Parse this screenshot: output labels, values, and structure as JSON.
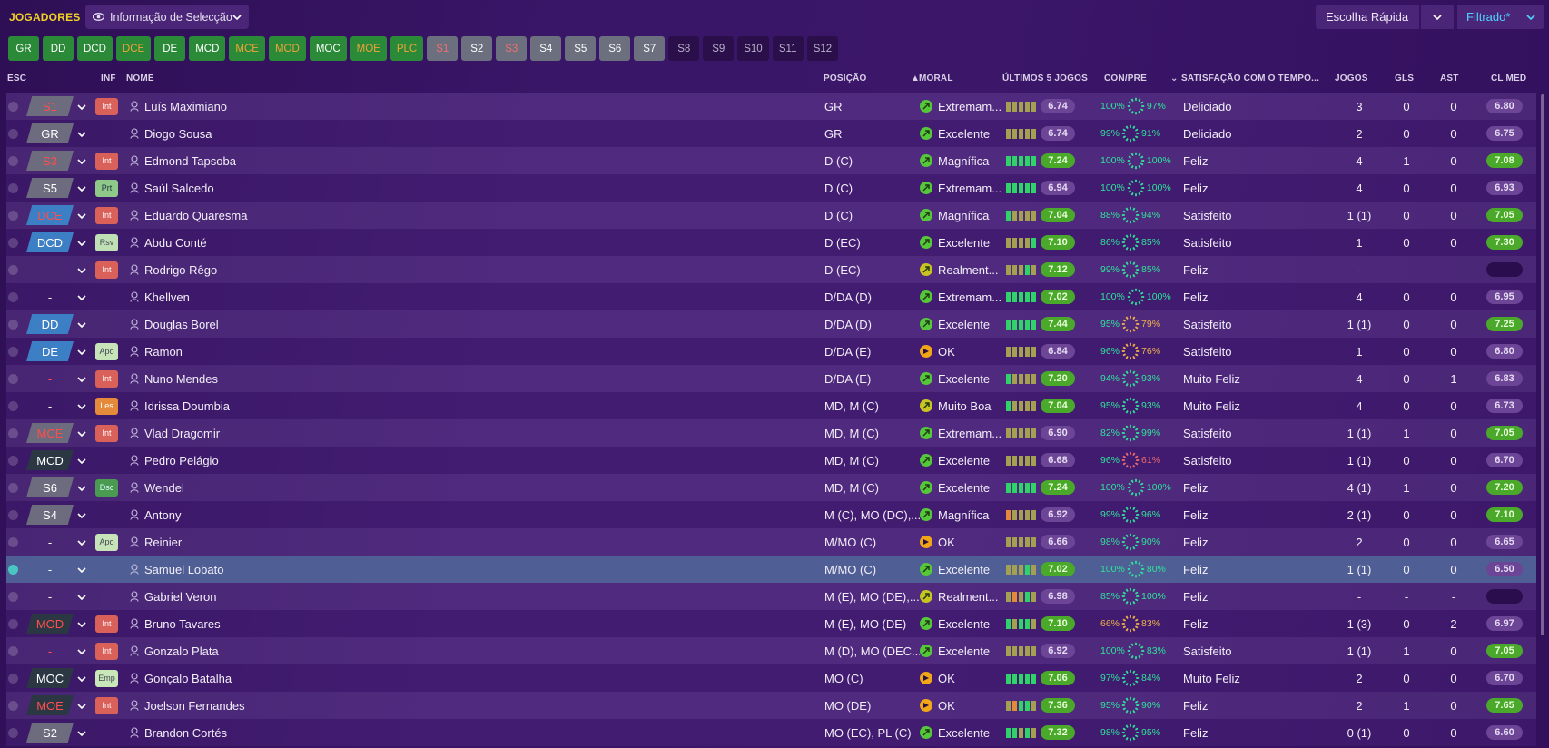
{
  "header": {
    "title": "JOGADORES",
    "view_select": "Informação de Selecção",
    "quick_pick": "Escolha Rápida",
    "filter": "Filtrado*"
  },
  "chips": [
    {
      "label": "GR",
      "style": "green"
    },
    {
      "label": "DD",
      "style": "green"
    },
    {
      "label": "DCD",
      "style": "green"
    },
    {
      "label": "DCE",
      "style": "green red"
    },
    {
      "label": "DE",
      "style": "green"
    },
    {
      "label": "MCD",
      "style": "green"
    },
    {
      "label": "MCE",
      "style": "green red"
    },
    {
      "label": "MOD",
      "style": "green red"
    },
    {
      "label": "MOC",
      "style": "green"
    },
    {
      "label": "MOE",
      "style": "green red"
    },
    {
      "label": "PLC",
      "style": "green red"
    },
    {
      "label": "S1",
      "style": "grey red"
    },
    {
      "label": "S2",
      "style": "grey"
    },
    {
      "label": "S3",
      "style": "grey red"
    },
    {
      "label": "S4",
      "style": "grey"
    },
    {
      "label": "S5",
      "style": "grey"
    },
    {
      "label": "S6",
      "style": "grey"
    },
    {
      "label": "S7",
      "style": "grey"
    },
    {
      "label": "S8",
      "style": "dark"
    },
    {
      "label": "S9",
      "style": "dark"
    },
    {
      "label": "S10",
      "style": "dark"
    },
    {
      "label": "S11",
      "style": "dark"
    },
    {
      "label": "S12",
      "style": "dark"
    }
  ],
  "columns": {
    "esc": "ESC",
    "inf": "INF",
    "nome": "NOME",
    "posicao": "POSIÇÃO",
    "moral": "MORAL",
    "ultimos5": "ÚLTIMOS 5 JOGOS",
    "conpre": "CON/PRE",
    "satisfacao": "SATISFAÇÃO COM O TEMPO...",
    "jogos": "JOGOS",
    "gls": "GLS",
    "ast": "AST",
    "clmed": "CL MED"
  },
  "colors": {
    "bar_green": "#2fd36a",
    "bar_olive": "#a3a052",
    "bar_orange": "#e08a3a",
    "ring_green": "#2fe39a",
    "ring_orange": "#f0b24a",
    "ring_red": "#ef6a6a"
  },
  "players": [
    {
      "esc": "S1",
      "esc_style": "grey",
      "esc_red": true,
      "inf": "Int",
      "inf_style": "b-int",
      "name": "Luís Maximiano",
      "pos": "GR",
      "moral": "Extremam...",
      "moral_icon": "green",
      "bars": [
        "o",
        "o",
        "o",
        "o",
        "o"
      ],
      "rating": "6.74",
      "rating_style": "r-purple",
      "con": "100%",
      "pre": "97%",
      "ring": "green",
      "satis": "Deliciado",
      "jogos": "3",
      "gls": "0",
      "ast": "0",
      "clmed": "6.80",
      "clmed_style": "r-purple"
    },
    {
      "esc": "GR",
      "esc_style": "grey",
      "esc_red": false,
      "inf": "",
      "inf_style": "",
      "name": "Diogo Sousa",
      "pos": "GR",
      "moral": "Excelente",
      "moral_icon": "green",
      "bars": [
        "o",
        "o",
        "o",
        "o",
        "o"
      ],
      "rating": "6.74",
      "rating_style": "r-purple",
      "con": "99%",
      "pre": "91%",
      "ring": "green",
      "satis": "Deliciado",
      "jogos": "2",
      "gls": "0",
      "ast": "0",
      "clmed": "6.75",
      "clmed_style": "r-purple"
    },
    {
      "esc": "S3",
      "esc_style": "grey",
      "esc_red": true,
      "inf": "Int",
      "inf_style": "b-int",
      "name": "Edmond Tapsoba",
      "pos": "D (C)",
      "moral": "Magnífica",
      "moral_icon": "green",
      "bars": [
        "g",
        "g",
        "g",
        "g",
        "g"
      ],
      "rating": "7.24",
      "rating_style": "r-green",
      "con": "100%",
      "pre": "100%",
      "ring": "green",
      "satis": "Feliz",
      "jogos": "4",
      "gls": "1",
      "ast": "0",
      "clmed": "7.08",
      "clmed_style": "r-green"
    },
    {
      "esc": "S5",
      "esc_style": "grey",
      "esc_red": false,
      "inf": "Prt",
      "inf_style": "b-prt",
      "name": "Saúl Salcedo",
      "pos": "D (C)",
      "moral": "Extremam...",
      "moral_icon": "green",
      "bars": [
        "g",
        "g",
        "g",
        "g",
        "g"
      ],
      "rating": "6.94",
      "rating_style": "r-purple",
      "con": "100%",
      "pre": "100%",
      "ring": "green",
      "satis": "Feliz",
      "jogos": "4",
      "gls": "0",
      "ast": "0",
      "clmed": "6.93",
      "clmed_style": "r-purple"
    },
    {
      "esc": "DCE",
      "esc_style": "blue",
      "esc_red": true,
      "inf": "Int",
      "inf_style": "b-int",
      "name": "Eduardo Quaresma",
      "pos": "D (C)",
      "moral": "Magnífica",
      "moral_icon": "green",
      "bars": [
        "g",
        "o",
        "o",
        "o",
        "o"
      ],
      "rating": "7.04",
      "rating_style": "r-green",
      "con": "88%",
      "pre": "94%",
      "ring": "green",
      "satis": "Satisfeito",
      "jogos": "1 (1)",
      "gls": "0",
      "ast": "0",
      "clmed": "7.05",
      "clmed_style": "r-green"
    },
    {
      "esc": "DCD",
      "esc_style": "blue",
      "esc_red": false,
      "inf": "Rsv",
      "inf_style": "b-rsv",
      "name": "Abdu Conté",
      "pos": "D (EC)",
      "moral": "Excelente",
      "moral_icon": "green",
      "bars": [
        "o",
        "o",
        "o",
        "o",
        "g"
      ],
      "rating": "7.10",
      "rating_style": "r-green",
      "con": "86%",
      "pre": "85%",
      "ring": "green",
      "satis": "Satisfeito",
      "jogos": "1",
      "gls": "0",
      "ast": "0",
      "clmed": "7.30",
      "clmed_style": "r-green"
    },
    {
      "esc": "-",
      "esc_style": "none",
      "esc_red": true,
      "inf": "Int",
      "inf_style": "b-int",
      "name": "Rodrigo Rêgo",
      "pos": "D (EC)",
      "moral": "Realment...",
      "moral_icon": "yellow",
      "bars": [
        "o",
        "o",
        "o",
        "g",
        "o"
      ],
      "rating": "7.12",
      "rating_style": "r-green",
      "con": "99%",
      "pre": "85%",
      "ring": "green",
      "satis": "Feliz",
      "jogos": "-",
      "gls": "-",
      "ast": "-",
      "clmed": "",
      "clmed_style": "r-empty"
    },
    {
      "esc": "-",
      "esc_style": "none",
      "esc_red": false,
      "inf": "",
      "inf_style": "",
      "name": "Khellven",
      "pos": "D/DA (D)",
      "moral": "Extremam...",
      "moral_icon": "green",
      "bars": [
        "g",
        "g",
        "g",
        "g",
        "g"
      ],
      "rating": "7.02",
      "rating_style": "r-green",
      "con": "100%",
      "pre": "100%",
      "ring": "green",
      "satis": "Feliz",
      "jogos": "4",
      "gls": "0",
      "ast": "0",
      "clmed": "6.95",
      "clmed_style": "r-purple"
    },
    {
      "esc": "DD",
      "esc_style": "blue",
      "esc_red": false,
      "inf": "",
      "inf_style": "",
      "name": "Douglas Borel",
      "pos": "D/DA (D)",
      "moral": "Excelente",
      "moral_icon": "green",
      "bars": [
        "g",
        "g",
        "g",
        "g",
        "g"
      ],
      "rating": "7.44",
      "rating_style": "r-green",
      "con": "95%",
      "pre": "79%",
      "ring": "orange",
      "satis": "Satisfeito",
      "jogos": "1 (1)",
      "gls": "0",
      "ast": "0",
      "clmed": "7.25",
      "clmed_style": "r-green"
    },
    {
      "esc": "DE",
      "esc_style": "blue",
      "esc_red": false,
      "inf": "Apo",
      "inf_style": "b-apo",
      "name": "Ramon",
      "pos": "D/DA (E)",
      "moral": "OK",
      "moral_icon": "orange",
      "bars": [
        "o",
        "o",
        "o",
        "o",
        "o"
      ],
      "rating": "6.84",
      "rating_style": "r-purple",
      "con": "96%",
      "pre": "76%",
      "ring": "orange",
      "satis": "Satisfeito",
      "jogos": "1",
      "gls": "0",
      "ast": "0",
      "clmed": "6.80",
      "clmed_style": "r-purple"
    },
    {
      "esc": "-",
      "esc_style": "none",
      "esc_red": true,
      "inf": "Int",
      "inf_style": "b-int",
      "name": "Nuno Mendes",
      "pos": "D/DA (E)",
      "moral": "Excelente",
      "moral_icon": "green",
      "bars": [
        "g",
        "o",
        "o",
        "o",
        "o"
      ],
      "rating": "7.20",
      "rating_style": "r-green",
      "con": "94%",
      "pre": "93%",
      "ring": "green",
      "satis": "Muito Feliz",
      "jogos": "4",
      "gls": "0",
      "ast": "1",
      "clmed": "6.83",
      "clmed_style": "r-purple"
    },
    {
      "esc": "-",
      "esc_style": "none",
      "esc_red": false,
      "inf": "Les",
      "inf_style": "b-les",
      "name": "Idrissa Doumbia",
      "pos": "MD, M (C)",
      "moral": "Muito Boa",
      "moral_icon": "yellow",
      "bars": [
        "g",
        "o",
        "o",
        "o",
        "o"
      ],
      "rating": "7.04",
      "rating_style": "r-green",
      "con": "95%",
      "pre": "93%",
      "ring": "green",
      "satis": "Muito Feliz",
      "jogos": "4",
      "gls": "0",
      "ast": "0",
      "clmed": "6.73",
      "clmed_style": "r-purple"
    },
    {
      "esc": "MCE",
      "esc_style": "grey",
      "esc_red": true,
      "inf": "Int",
      "inf_style": "b-int",
      "name": "Vlad Dragomir",
      "pos": "MD, M (C)",
      "moral": "Extremam...",
      "moral_icon": "green",
      "bars": [
        "o",
        "o",
        "o",
        "o",
        "o"
      ],
      "rating": "6.90",
      "rating_style": "r-purple",
      "con": "82%",
      "pre": "99%",
      "ring": "green",
      "satis": "Satisfeito",
      "jogos": "1 (1)",
      "gls": "1",
      "ast": "0",
      "clmed": "7.05",
      "clmed_style": "r-green"
    },
    {
      "esc": "MCD",
      "esc_style": "dark",
      "esc_red": false,
      "inf": "",
      "inf_style": "",
      "name": "Pedro Pelágio",
      "pos": "MD, M (C)",
      "moral": "Excelente",
      "moral_icon": "green",
      "bars": [
        "o",
        "o",
        "o",
        "o",
        "o"
      ],
      "rating": "6.68",
      "rating_style": "r-purple",
      "con": "96%",
      "pre": "61%",
      "ring": "red",
      "satis": "Satisfeito",
      "jogos": "1 (1)",
      "gls": "0",
      "ast": "0",
      "clmed": "6.70",
      "clmed_style": "r-purple"
    },
    {
      "esc": "S6",
      "esc_style": "grey",
      "esc_red": false,
      "inf": "Dsc",
      "inf_style": "b-dsc",
      "name": "Wendel",
      "pos": "MD, M (C)",
      "moral": "Excelente",
      "moral_icon": "green",
      "bars": [
        "g",
        "g",
        "g",
        "g",
        "g"
      ],
      "rating": "7.24",
      "rating_style": "r-green",
      "con": "100%",
      "pre": "100%",
      "ring": "green",
      "satis": "Feliz",
      "jogos": "4 (1)",
      "gls": "1",
      "ast": "0",
      "clmed": "7.20",
      "clmed_style": "r-green"
    },
    {
      "esc": "S4",
      "esc_style": "grey",
      "esc_red": false,
      "inf": "",
      "inf_style": "",
      "name": "Antony",
      "pos": "M (C), MO (DC),...",
      "moral": "Magnífica",
      "moral_icon": "green",
      "bars": [
        "x",
        "o",
        "o",
        "o",
        "o"
      ],
      "rating": "6.92",
      "rating_style": "r-purple",
      "con": "99%",
      "pre": "96%",
      "ring": "green",
      "satis": "Feliz",
      "jogos": "2 (1)",
      "gls": "0",
      "ast": "0",
      "clmed": "7.10",
      "clmed_style": "r-green"
    },
    {
      "esc": "-",
      "esc_style": "none",
      "esc_red": false,
      "inf": "Apo",
      "inf_style": "b-apo",
      "name": "Reinier",
      "pos": "M/MO (C)",
      "moral": "OK",
      "moral_icon": "orange",
      "bars": [
        "o",
        "o",
        "o",
        "o",
        "o"
      ],
      "rating": "6.66",
      "rating_style": "r-purple",
      "con": "98%",
      "pre": "90%",
      "ring": "green",
      "satis": "Feliz",
      "jogos": "2",
      "gls": "0",
      "ast": "0",
      "clmed": "6.65",
      "clmed_style": "r-purple"
    },
    {
      "esc": "-",
      "esc_style": "none",
      "esc_red": false,
      "inf": "",
      "inf_style": "",
      "name": "Samuel Lobato",
      "pos": "M/MO (C)",
      "moral": "Excelente",
      "moral_icon": "green",
      "bars": [
        "o",
        "o",
        "o",
        "g",
        "o"
      ],
      "rating": "7.02",
      "rating_style": "r-green",
      "con": "100%",
      "pre": "80%",
      "ring": "green",
      "satis": "Feliz",
      "jogos": "1 (1)",
      "gls": "0",
      "ast": "0",
      "clmed": "6.50",
      "clmed_style": "r-purple",
      "selected": true
    },
    {
      "esc": "-",
      "esc_style": "none",
      "esc_red": false,
      "inf": "",
      "inf_style": "",
      "name": "Gabriel Veron",
      "pos": "M (E), MO (DE),...",
      "moral": "Realment...",
      "moral_icon": "yellow",
      "bars": [
        "o",
        "x",
        "o",
        "g",
        "o"
      ],
      "rating": "6.98",
      "rating_style": "r-purple",
      "con": "85%",
      "pre": "100%",
      "ring": "green",
      "satis": "Feliz",
      "jogos": "-",
      "gls": "-",
      "ast": "-",
      "clmed": "",
      "clmed_style": "r-empty"
    },
    {
      "esc": "MOD",
      "esc_style": "dark",
      "esc_red": true,
      "inf": "Int",
      "inf_style": "b-int",
      "name": "Bruno Tavares",
      "pos": "M (E), MO (DE)",
      "moral": "Excelente",
      "moral_icon": "green",
      "bars": [
        "g",
        "o",
        "g",
        "g",
        "o"
      ],
      "rating": "7.10",
      "rating_style": "r-green",
      "con": "66%",
      "pre": "83%",
      "ring": "orange",
      "satis": "Feliz",
      "jogos": "1 (3)",
      "gls": "0",
      "ast": "2",
      "clmed": "6.97",
      "clmed_style": "r-purple"
    },
    {
      "esc": "-",
      "esc_style": "none",
      "esc_red": true,
      "inf": "Int",
      "inf_style": "b-int",
      "name": "Gonzalo Plata",
      "pos": "M (D), MO (DEC...",
      "moral": "Excelente",
      "moral_icon": "green",
      "bars": [
        "o",
        "o",
        "o",
        "o",
        "o"
      ],
      "rating": "6.92",
      "rating_style": "r-purple",
      "con": "100%",
      "pre": "83%",
      "ring": "green",
      "satis": "Satisfeito",
      "jogos": "1 (1)",
      "gls": "1",
      "ast": "0",
      "clmed": "7.05",
      "clmed_style": "r-green"
    },
    {
      "esc": "MOC",
      "esc_style": "dark",
      "esc_red": false,
      "inf": "Emp",
      "inf_style": "b-emp",
      "name": "Gonçalo Batalha",
      "pos": "MO (C)",
      "moral": "OK",
      "moral_icon": "orange",
      "bars": [
        "g",
        "g",
        "g",
        "g",
        "g"
      ],
      "rating": "7.06",
      "rating_style": "r-green",
      "con": "97%",
      "pre": "84%",
      "ring": "green",
      "satis": "Muito Feliz",
      "jogos": "2",
      "gls": "0",
      "ast": "0",
      "clmed": "6.70",
      "clmed_style": "r-purple"
    },
    {
      "esc": "MOE",
      "esc_style": "dark",
      "esc_red": true,
      "inf": "Int",
      "inf_style": "b-int",
      "name": "Joelson Fernandes",
      "pos": "MO (DE)",
      "moral": "OK",
      "moral_icon": "orange",
      "bars": [
        "o",
        "x",
        "g",
        "g",
        "o"
      ],
      "rating": "7.36",
      "rating_style": "r-green",
      "con": "95%",
      "pre": "90%",
      "ring": "green",
      "satis": "Feliz",
      "jogos": "2",
      "gls": "1",
      "ast": "0",
      "clmed": "7.65",
      "clmed_style": "r-green"
    },
    {
      "esc": "S2",
      "esc_style": "grey",
      "esc_red": false,
      "inf": "",
      "inf_style": "",
      "name": "Brandon Cortés",
      "pos": "MO (EC), PL (C)",
      "moral": "Excelente",
      "moral_icon": "green",
      "bars": [
        "g",
        "g",
        "o",
        "g",
        "o"
      ],
      "rating": "7.32",
      "rating_style": "r-green",
      "con": "98%",
      "pre": "95%",
      "ring": "green",
      "satis": "Feliz",
      "jogos": "0 (1)",
      "gls": "0",
      "ast": "0",
      "clmed": "6.60",
      "clmed_style": "r-purple"
    }
  ]
}
